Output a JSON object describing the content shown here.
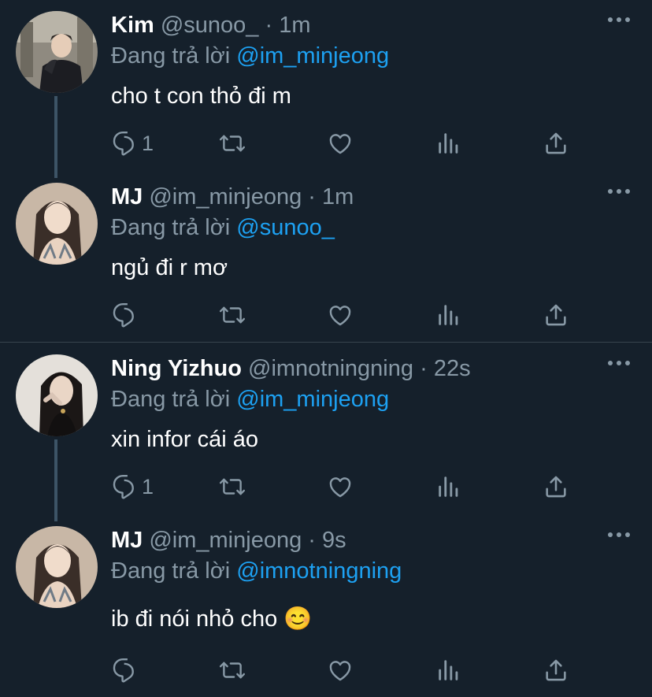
{
  "tweets": [
    {
      "name": "Kim",
      "handle": "@sunoo_",
      "dot": "·",
      "time": "1m",
      "reply_prefix": "Đang trả lời",
      "reply_to": "@im_minjeong",
      "text": "cho t con thỏ đi m",
      "reply_count": "1"
    },
    {
      "name": "MJ",
      "handle": "@im_minjeong",
      "dot": "·",
      "time": "1m",
      "reply_prefix": "Đang trả lời",
      "reply_to": "@sunoo_",
      "text": "ngủ đi r mơ",
      "reply_count": ""
    },
    {
      "name": "Ning Yizhuo",
      "handle": "@imnotningning",
      "dot": "·",
      "time": "22s",
      "reply_prefix": "Đang trả lời",
      "reply_to": "@im_minjeong",
      "text": "xin infor cái áo",
      "reply_count": "1"
    },
    {
      "name": "MJ",
      "handle": "@im_minjeong",
      "dot": "·",
      "time": "9s",
      "reply_prefix": "Đang trả lời",
      "reply_to": "@imnotningning",
      "text": "ib đi nói nhỏ cho 😊",
      "reply_count": ""
    }
  ],
  "icons": {
    "reply": "reply-icon",
    "retweet": "retweet-icon",
    "like": "like-icon",
    "stats": "stats-icon",
    "share": "share-icon",
    "more": "more-icon"
  },
  "colors": {
    "background": "#15202b",
    "secondary_text": "#8899a6",
    "mention": "#1da1f2",
    "thread_line": "#3d5466"
  }
}
